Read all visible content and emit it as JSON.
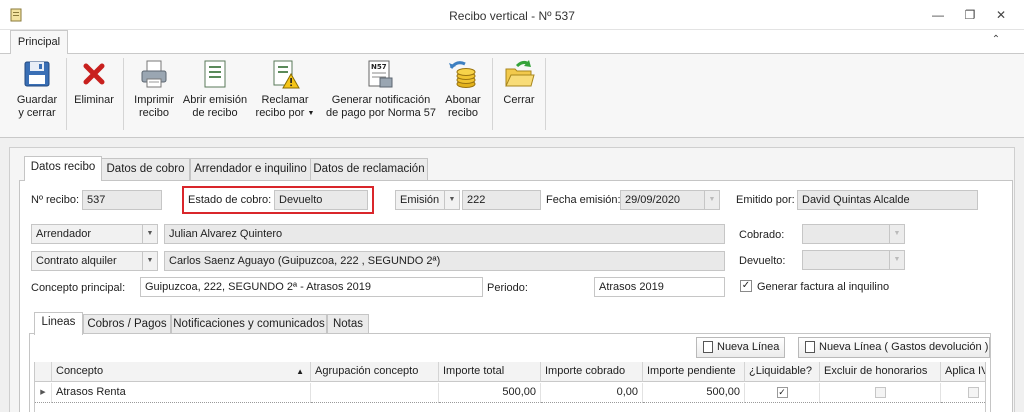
{
  "window": {
    "title": "Recibo vertical - Nº 537",
    "controls": {
      "minimize": "—",
      "restore": "❐",
      "close": "✕"
    }
  },
  "ribbon": {
    "tab": "Principal",
    "collapse_icon": "chevron-up-icon",
    "buttons": [
      {
        "id": "save",
        "label": "Guardar\ny cerrar",
        "icon": "save-icon"
      },
      {
        "id": "delete",
        "label": "Eliminar",
        "icon": "delete-icon"
      },
      {
        "id": "print",
        "label": "Imprimir\nrecibo",
        "icon": "printer-icon"
      },
      {
        "id": "open",
        "label": "Abrir emisión\nde recibo",
        "icon": "document-icon"
      },
      {
        "id": "claim",
        "label": "Reclamar\nrecibo por",
        "icon": "warning-document-icon"
      },
      {
        "id": "notify",
        "label": "Generar notificación\nde pago por Norma 57",
        "icon": "n57-icon"
      },
      {
        "id": "pay",
        "label": "Abonar\nrecibo",
        "icon": "coins-icon"
      },
      {
        "id": "close",
        "label": "Cerrar",
        "icon": "folder-exit-icon"
      }
    ]
  },
  "tabs": [
    "Datos recibo",
    "Datos de cobro",
    "Arrendador e inquilino",
    "Datos de reclamación"
  ],
  "form": {
    "num_recibo_label": "Nº recibo:",
    "num_recibo": "537",
    "estado_label": "Estado de cobro:",
    "estado": "Devuelto",
    "emision_combo": "Emisión",
    "emision_num": "222",
    "fecha_label": "Fecha emisión:",
    "fecha": "29/09/2020",
    "emitido_label": "Emitido por:",
    "emitido": "David Quintas Alcalde",
    "arrendador_combo": "Arrendador",
    "arrendador": "Julian Alvarez Quintero",
    "cobrado_label": "Cobrado:",
    "contrato_combo": "Contrato alquiler",
    "contrato": "Carlos Saenz Aguayo (Guipuzcoa, 222 , SEGUNDO 2ª)",
    "devuelto_label": "Devuelto:",
    "concepto_label": "Concepto principal:",
    "concepto": "Guipuzcoa, 222, SEGUNDO 2ª - Atrasos 2019",
    "periodo_label": "Periodo:",
    "periodo": "Atrasos 2019",
    "generar_factura_label": "Generar factura al inquilino",
    "generar_factura_checked": true
  },
  "inner_tabs": [
    "Lineas",
    "Cobros / Pagos",
    "Notificaciones y comunicados",
    "Notas"
  ],
  "toolbar": {
    "nueva_linea": "Nueva Línea",
    "nueva_linea_gastos": "Nueva Línea ( Gastos devolución )"
  },
  "grid": {
    "columns": [
      "Concepto",
      "Agrupación concepto",
      "Importe total",
      "Importe cobrado",
      "Importe pendiente",
      "¿Liquidable?",
      "Excluir de honorarios",
      "Aplica IVA"
    ],
    "rows": [
      {
        "concepto": "Atrasos Renta",
        "agrupacion": "",
        "importe_total": "500,00",
        "importe_cobrado": "0,00",
        "importe_pendiente": "500,00",
        "liquidable": true,
        "excluir": false,
        "aplica_iva": false
      }
    ]
  }
}
